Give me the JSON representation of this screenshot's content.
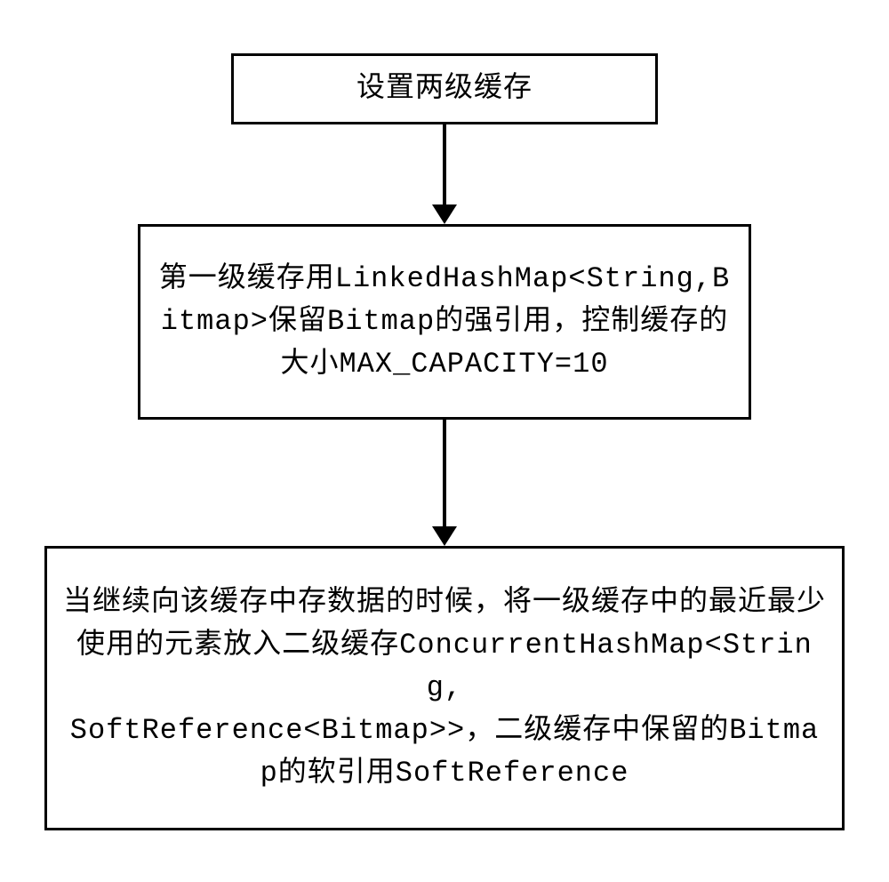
{
  "flow": {
    "box1": "设置两级缓存",
    "box2": "第一级缓存用LinkedHashMap<String,Bitmap>保留Bitmap的强引用，控制缓存的大小MAX_CAPACITY=10",
    "box3": "当继续向该缓存中存数据的时候，将一级缓存中的最近最少使用的元素放入二级缓存ConcurrentHashMap<String,\nSoftReference<Bitmap>>，二级缓存中保留的Bitmap的软引用SoftReference"
  },
  "arrows": {
    "a1_height": 90,
    "a2_height": 120
  }
}
